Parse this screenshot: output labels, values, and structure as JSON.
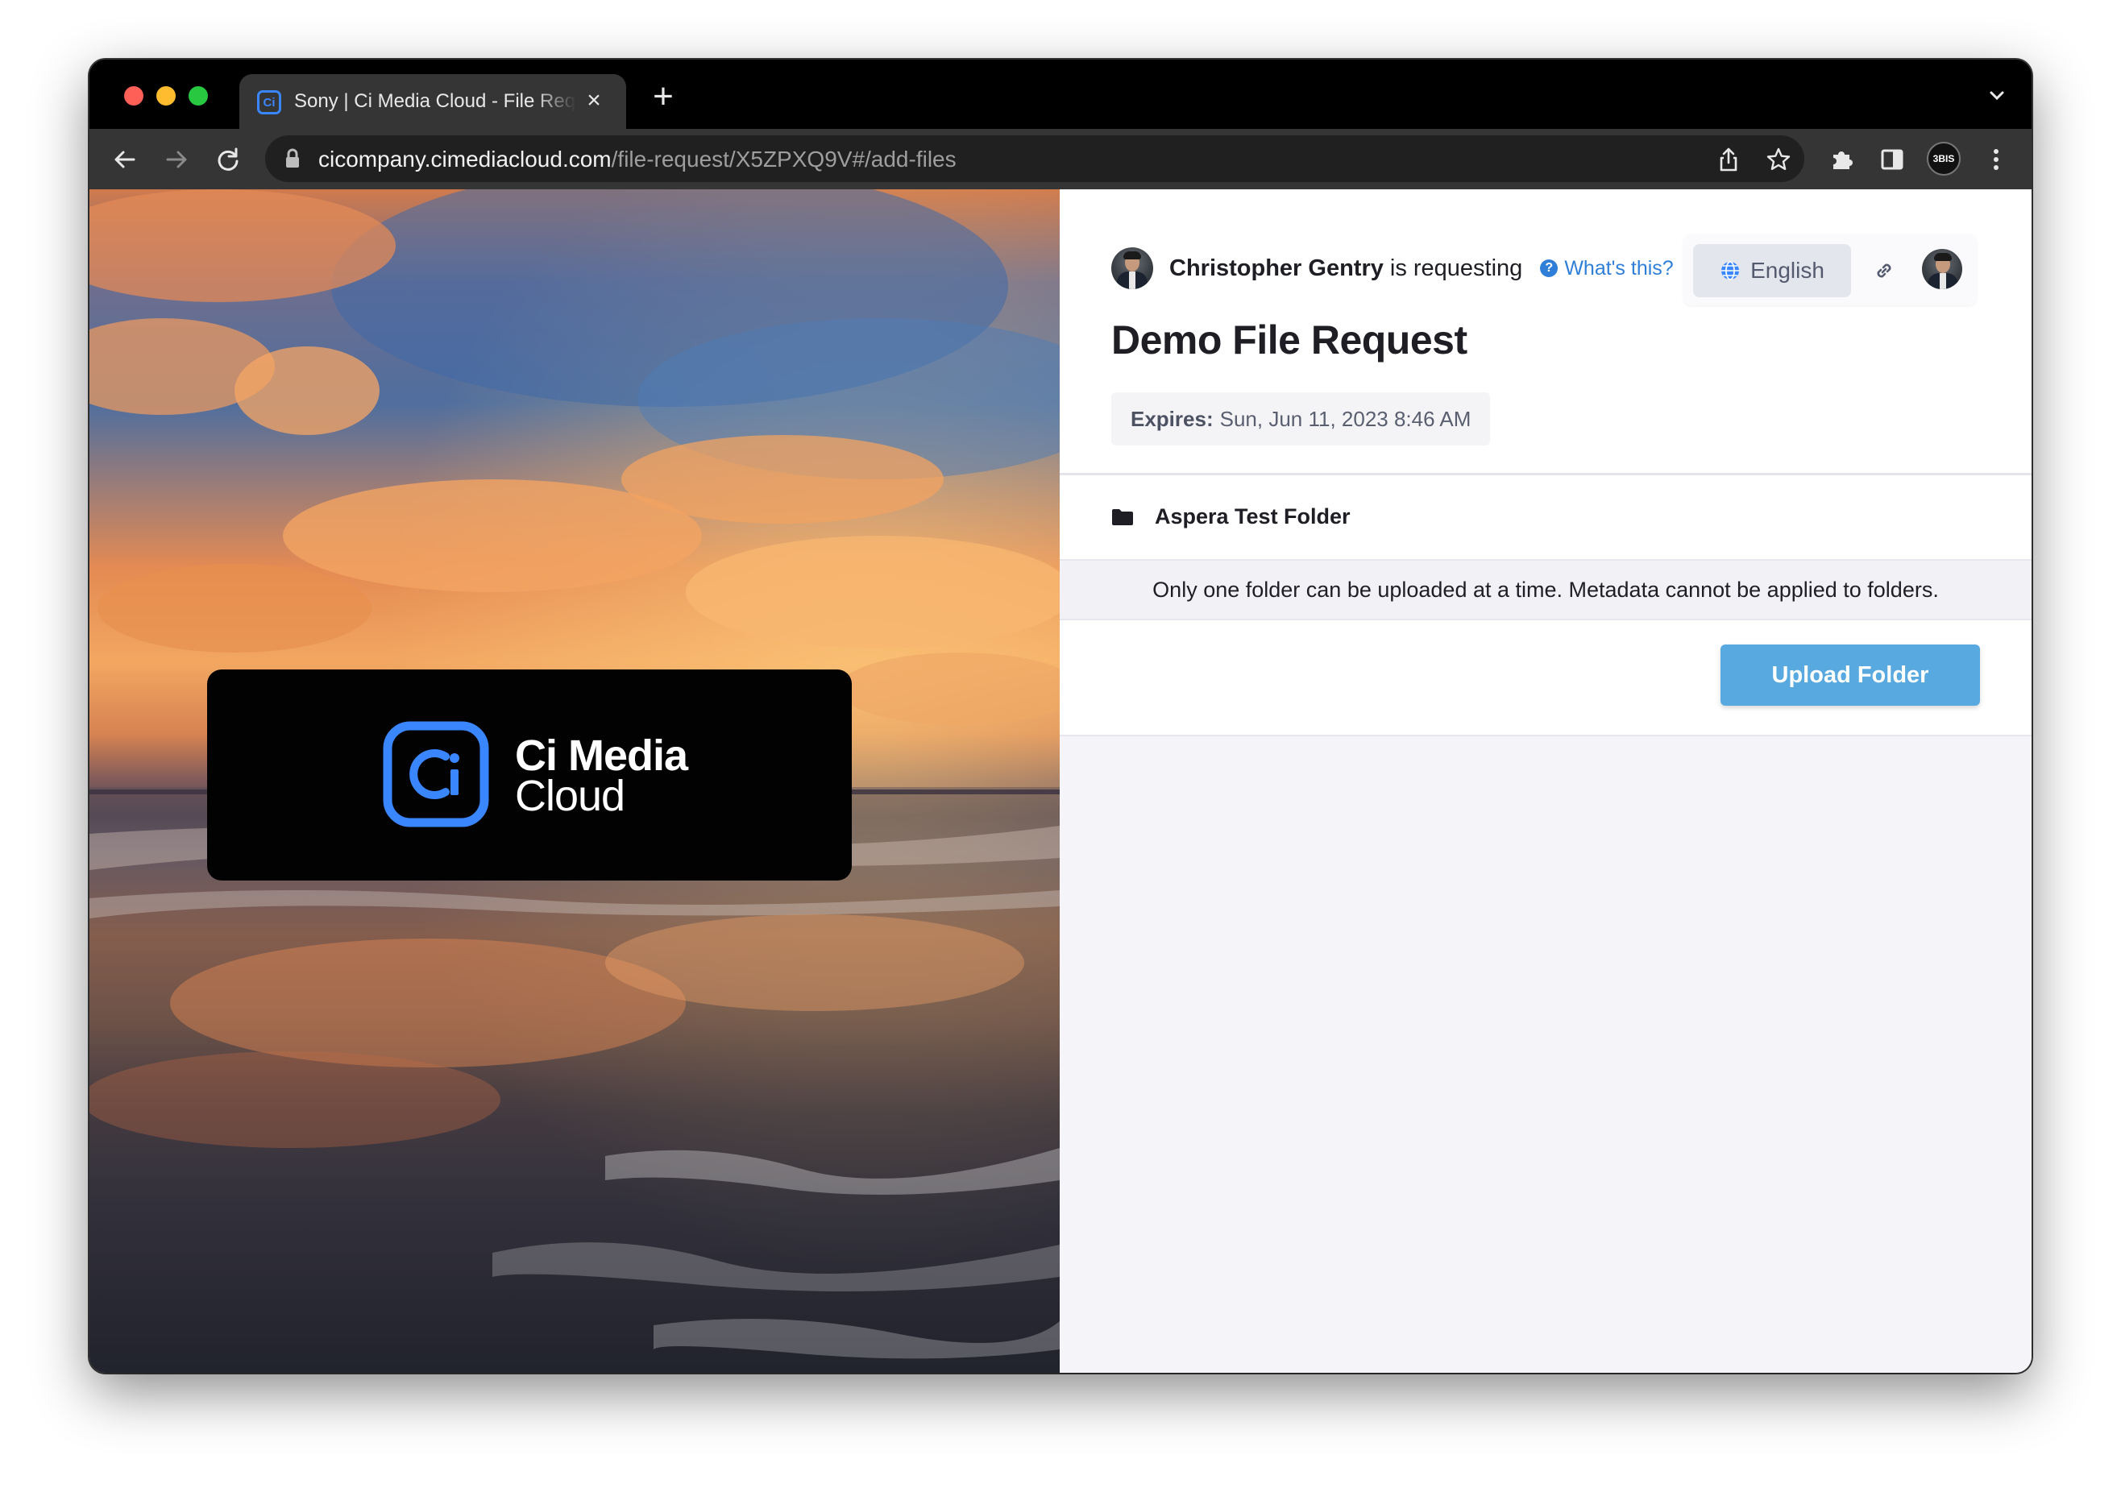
{
  "browser": {
    "tab_title": "Sony | Ci Media Cloud - File Request",
    "tab_favicon": "Ci",
    "url_host": "cicompany.cimediacloud.com",
    "url_path": "/file-request/X5ZPXQ9V#/add-files",
    "profile_badge": "3BIS"
  },
  "hero": {
    "logo_line1": "Ci Media",
    "logo_line2": "Cloud",
    "brand_color": "#3a86ff"
  },
  "request": {
    "requester_name": "Christopher Gentry",
    "requesting_text": "is requesting",
    "whats_this": "What's this?",
    "language": "English",
    "title": "Demo File Request",
    "expires_label": "Expires:",
    "expires_value": "Sun, Jun 11, 2023 8:46 AM",
    "folder_name": "Aspera Test Folder",
    "notice": "Only one folder can be uploaded at a time. Metadata cannot be applied to folders.",
    "upload_button": "Upload Folder"
  },
  "icons": {
    "back": "arrow-left-icon",
    "forward": "arrow-right-icon",
    "reload": "reload-icon",
    "lock": "lock-icon",
    "share": "share-icon",
    "bookmark": "star-icon",
    "extensions": "puzzle-icon",
    "side_panel": "side-panel-icon",
    "menu": "kebab-menu-icon",
    "globe": "globe-icon",
    "link": "link-icon",
    "folder": "folder-icon",
    "help": "question-circle-icon"
  },
  "colors": {
    "accent": "#2f7fd8",
    "upload_button": "#58a9e0"
  }
}
